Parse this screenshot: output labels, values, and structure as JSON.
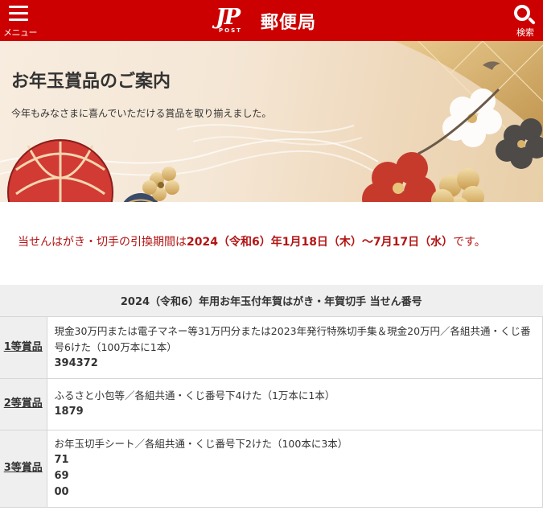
{
  "header": {
    "menu_label": "メニュー",
    "logo_mark": "JP",
    "logo_post": "POST",
    "logo_text": "郵便局",
    "search_label": "検索",
    "colors": {
      "brand": "#cc0000"
    }
  },
  "banner": {
    "title": "お年玉賞品のご案内",
    "subtitle": "今年もみなさまに喜んでいただける賞品を取り揃えました。"
  },
  "notice": {
    "prefix": "当せんはがき・切手の引換期間は",
    "period": "2024（令和6）年1月18日（木）～7月17日（水）",
    "suffix": "です。",
    "color": "#b31414"
  },
  "table": {
    "caption": "2024（令和6）年用お年玉付年賀はがき・年賀切手 当せん番号",
    "rows": [
      {
        "label": "1等賞品",
        "description": "現金30万円または電子マネー等31万円分または2023年発行特殊切手集＆現金20万円／各組共通・くじ番号6けた（100万本に1本）",
        "numbers": [
          "394372"
        ]
      },
      {
        "label": "2等賞品",
        "description": "ふるさと小包等／各組共通・くじ番号下4けた（1万本に1本）",
        "numbers": [
          "1879"
        ]
      },
      {
        "label": "3等賞品",
        "description": "お年玉切手シート／各組共通・くじ番号下2けた（100本に3本）",
        "numbers": [
          "71",
          "69",
          "00"
        ]
      }
    ]
  }
}
